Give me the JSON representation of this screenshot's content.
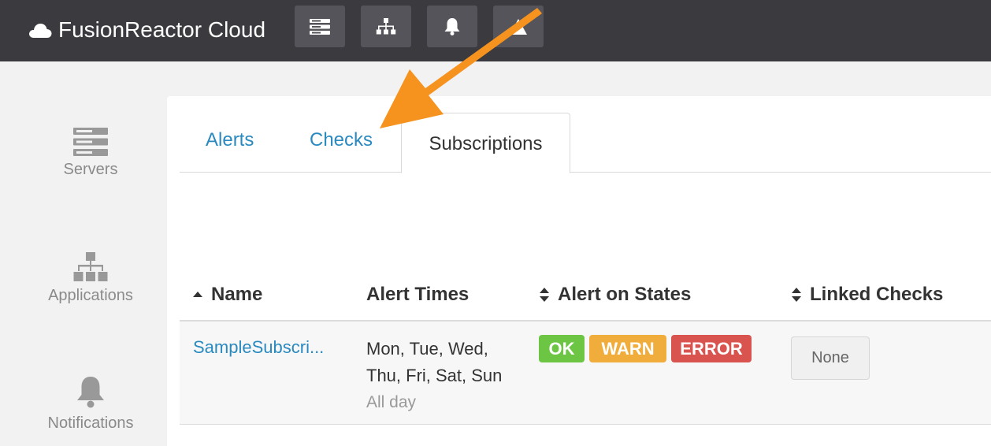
{
  "header": {
    "brand": "FusionReactor Cloud",
    "nav_icons": [
      "servers-icon",
      "applications-icon",
      "notifications-icon",
      "alerts-icon"
    ],
    "background": "#3b3a3f"
  },
  "sidebar": {
    "items": [
      {
        "label": "Servers",
        "icon": "servers-icon"
      },
      {
        "label": "Applications",
        "icon": "applications-icon"
      },
      {
        "label": "Notifications",
        "icon": "bell-icon"
      }
    ]
  },
  "tabs": [
    {
      "label": "Alerts",
      "active": false
    },
    {
      "label": "Checks",
      "active": false
    },
    {
      "label": "Subscriptions",
      "active": true
    }
  ],
  "table": {
    "columns": [
      {
        "label": "Name",
        "sort": "asc"
      },
      {
        "label": "Alert Times",
        "sort": null
      },
      {
        "label": "Alert on States",
        "sort": "both"
      },
      {
        "label": "Linked Checks",
        "sort": "both"
      }
    ],
    "rows": [
      {
        "name": "SampleSubscri...",
        "times_line1": "Mon, Tue, Wed,",
        "times_line2": "Thu, Fri, Sat, Sun",
        "times_line3": "All day",
        "states": [
          {
            "label": "OK",
            "color": "#6cc644"
          },
          {
            "label": "WARN",
            "color": "#f0ad3c"
          },
          {
            "label": "ERROR",
            "color": "#d9534f"
          }
        ],
        "linked_checks": "None"
      }
    ]
  },
  "annotation": {
    "color": "#f5931e"
  },
  "colors": {
    "link": "#2a8ac0"
  }
}
